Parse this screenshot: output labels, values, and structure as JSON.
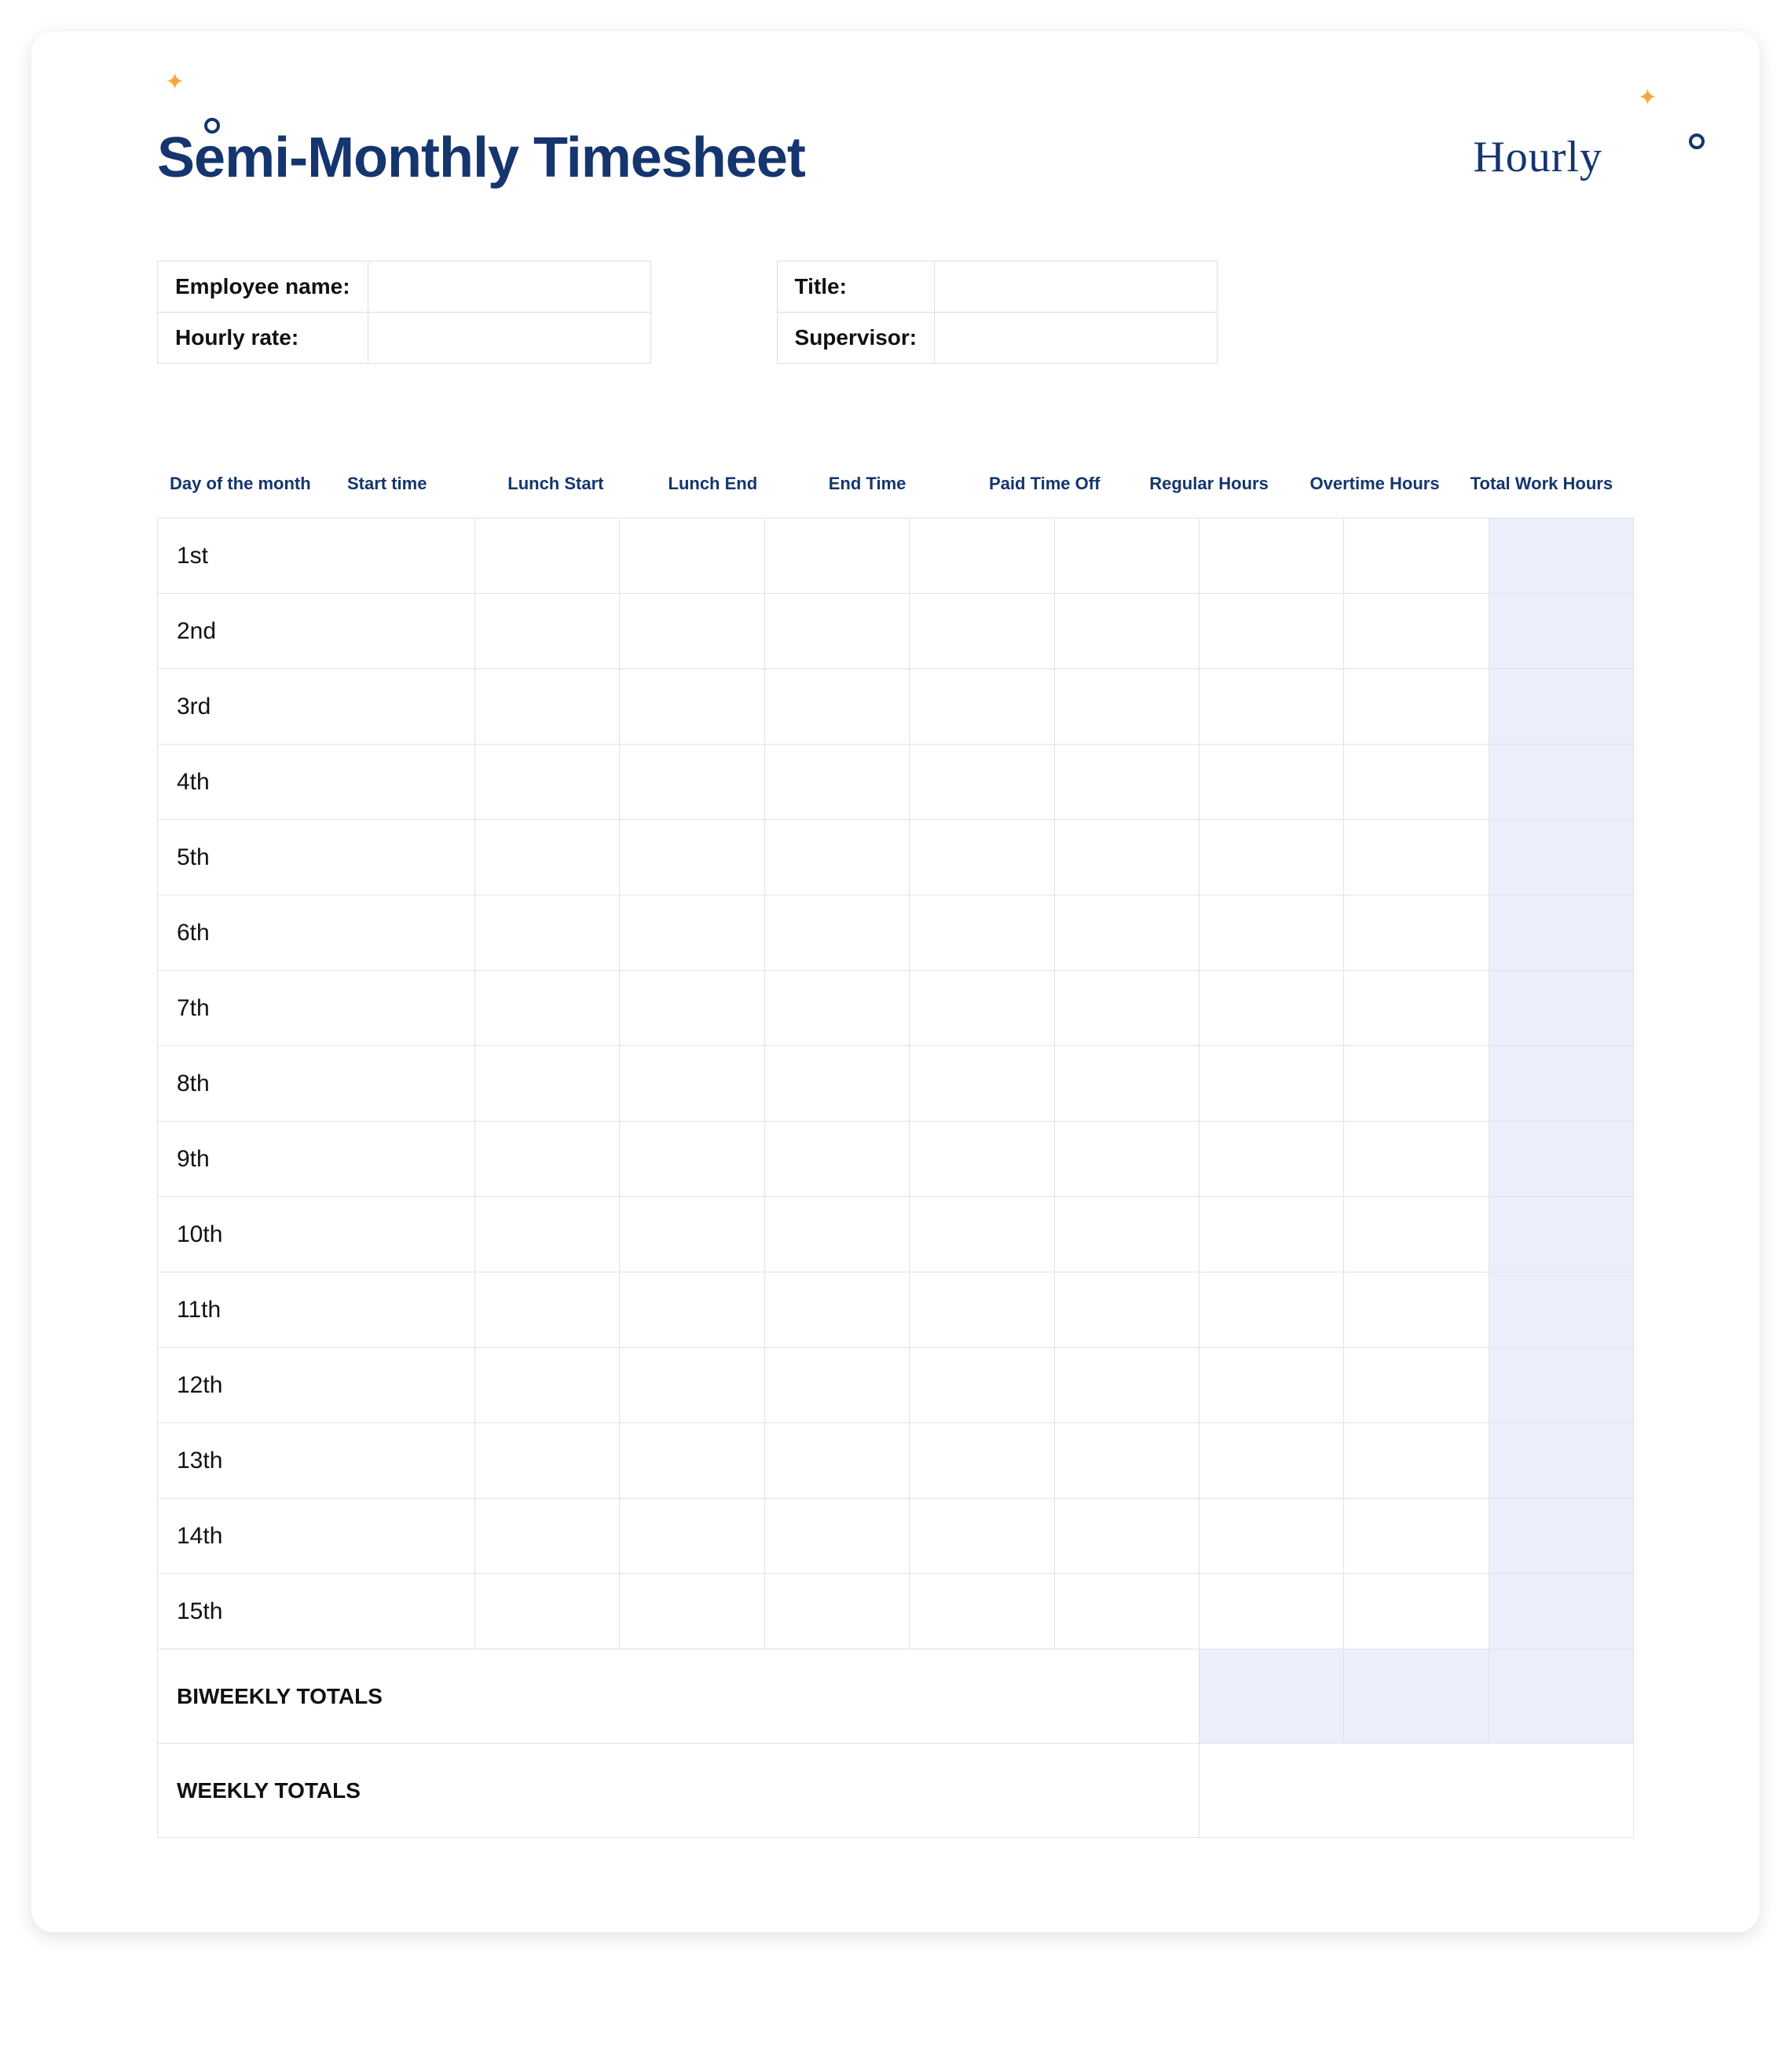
{
  "brand": "Hourly",
  "title": "Semi-Monthly Timesheet",
  "info_left": [
    {
      "label": "Employee name:",
      "value": ""
    },
    {
      "label": "Hourly rate:",
      "value": ""
    }
  ],
  "info_right": [
    {
      "label": "Title:",
      "value": ""
    },
    {
      "label": "Supervisor:",
      "value": ""
    }
  ],
  "columns": [
    "Day of the month",
    "Start time",
    "Lunch Start",
    "Lunch End",
    "End Time",
    "Paid Time Off",
    "Regular Hours",
    "Overtime Hours",
    "Total Work Hours"
  ],
  "days": [
    "1st",
    "2nd",
    "3rd",
    "4th",
    "5th",
    "6th",
    "7th",
    "8th",
    "9th",
    "10th",
    "11th",
    "12th",
    "13th",
    "14th",
    "15th"
  ],
  "totals": {
    "biweekly_label": "BIWEEKLY TOTALS",
    "weekly_label": "WEEKLY TOTALS"
  }
}
